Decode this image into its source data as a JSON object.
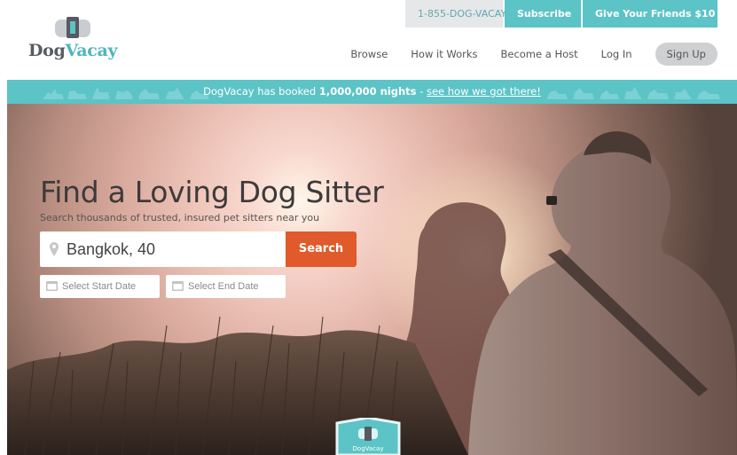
{
  "header": {
    "logo": {
      "part1": "Dog",
      "part2": "Vacay"
    },
    "top_links": {
      "phone": "1-855-DOG-VACAY",
      "subscribe": "Subscribe",
      "refer": "Give Your Friends $10"
    },
    "nav": {
      "browse": "Browse",
      "how_it_works": "How it Works",
      "become_host": "Become a Host",
      "log_in": "Log In",
      "sign_up": "Sign Up"
    }
  },
  "banner": {
    "prefix": "DogVacay has booked",
    "highlight": "1,000,000 nights",
    "separator": " - ",
    "link": "see how we got there!"
  },
  "hero": {
    "title": "Find a Loving Dog Sitter",
    "subtitle": "Search thousands of trusted, insured pet sitters near you",
    "location_value": "Bangkok, 40",
    "search_label": "Search",
    "start_date_placeholder": "Select Start Date",
    "end_date_placeholder": "Select End Date",
    "badge_text": "DogVacay"
  },
  "colors": {
    "brand_teal": "#5cc3c6",
    "search_orange": "#e05a2b",
    "logo_gray": "#555b60"
  },
  "icons": [
    "logo-bone-icon",
    "map-pin-icon",
    "calendar-icon",
    "shield-badge-icon"
  ]
}
